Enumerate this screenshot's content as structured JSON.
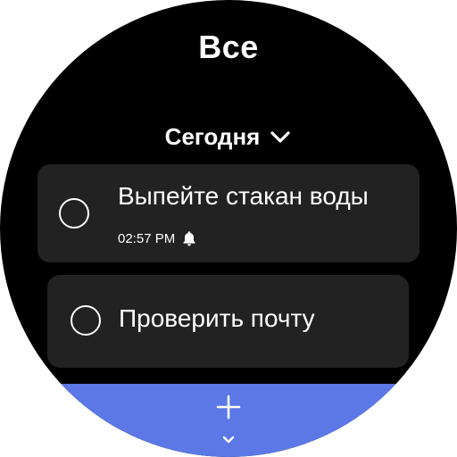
{
  "header": {
    "title": "Все"
  },
  "section": {
    "label": "Сегодня",
    "icon": "chevron-down-icon"
  },
  "tasks": [
    {
      "text": "Выпейте стакан воды",
      "time": "02:57 PM",
      "reminder_icon": "bell-icon"
    },
    {
      "text": "Проверить почту"
    }
  ],
  "footer": {
    "add_icon": "plus-icon",
    "more_icon": "chevron-down-icon",
    "color": "#5b78e6"
  },
  "colors": {
    "background": "#000000",
    "card": "#222222",
    "text": "#ffffff"
  }
}
